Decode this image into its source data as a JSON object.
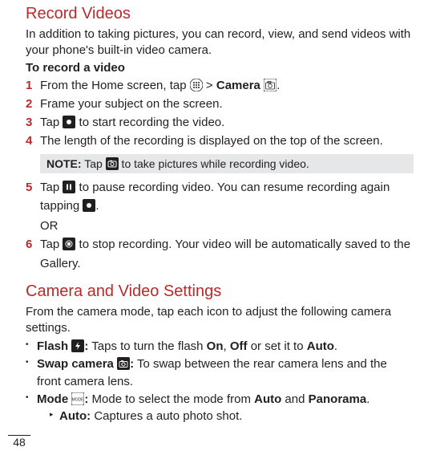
{
  "section1": {
    "title": "Record Videos",
    "intro": "In addition to taking pictures, you can record, view, and send videos with your phone's built-in video camera.",
    "subhead": "To record a video",
    "steps": {
      "1": {
        "pre": "From the Home screen, tap ",
        "gt": " > ",
        "camera_text": "Camera ",
        "post": "."
      },
      "2": {
        "text": "Frame your subject on the screen."
      },
      "3": {
        "pre": "Tap ",
        "post": " to start recording the video."
      },
      "4": {
        "text": "The length of the recording is displayed on the top of the screen."
      },
      "5": {
        "pre": "Tap ",
        "mid": " to pause recording video. You can resume recording again tapping ",
        "post": ".",
        "or": "OR"
      },
      "6": {
        "pre": "Tap ",
        "post": " to stop recording. Your video will be automatically saved to the Gallery."
      }
    },
    "note": {
      "label": "NOTE:",
      "pre": " Tap ",
      "post": " to take pictures while recording video."
    }
  },
  "section2": {
    "title": "Camera and Video Settings",
    "intro": "From the camera mode, tap each icon to adjust the following camera settings.",
    "b1": {
      "label": "Flash ",
      "post": " Taps to turn the flash ",
      "on": "On",
      "comma": ", ",
      "off": "Off",
      "or": " or set it to ",
      "auto": "Auto",
      "end": "."
    },
    "b2": {
      "label": "Swap camera ",
      "post": " To swap between the rear camera lens and the front camera lens."
    },
    "b3": {
      "label": "Mode ",
      "post": " Mode to select the mode from ",
      "auto": "Auto",
      "and": " and ",
      "pano": "Panorama",
      "end": "."
    },
    "sub1": {
      "label": "Auto:",
      "text": " Captures a auto photo shot."
    }
  },
  "page_number": "48"
}
